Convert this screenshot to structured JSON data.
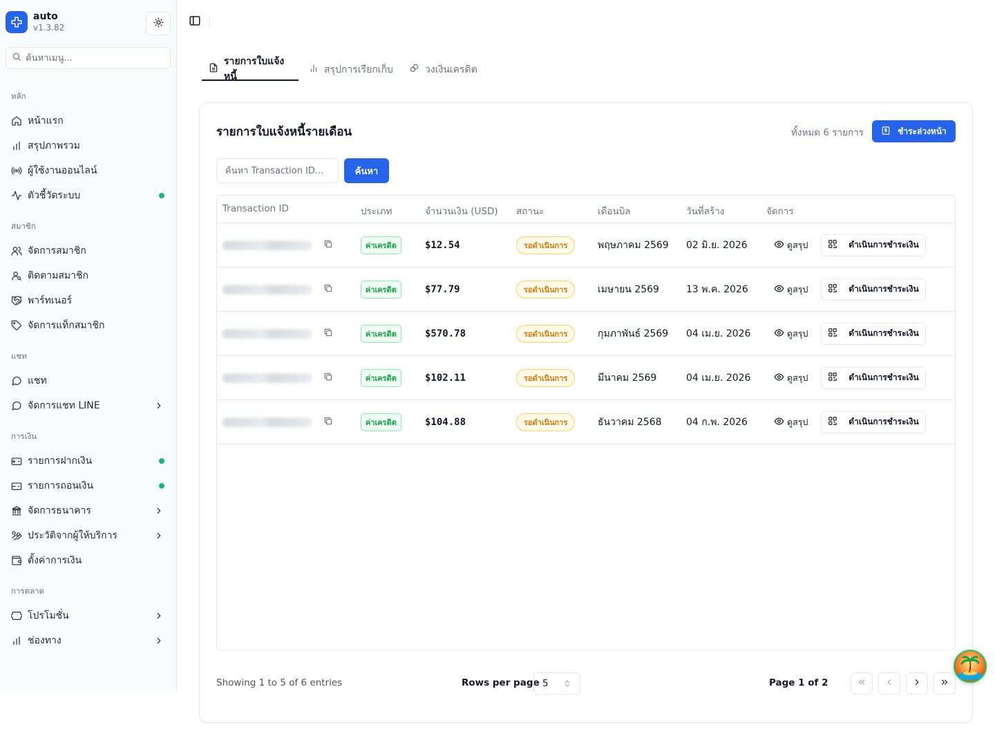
{
  "app": {
    "name": "auto",
    "version": "v1.3.82"
  },
  "sidebar": {
    "search_placeholder": "ค้นหาเมนู...",
    "sections": [
      {
        "label": "หลัก",
        "items": [
          {
            "label": "หน้าแรก",
            "icon": "home-icon"
          },
          {
            "label": "สรุปภาพรวม",
            "icon": "bar-chart-icon"
          },
          {
            "label": "ผู้ใช้งานออนไลน์",
            "icon": "radio-icon"
          },
          {
            "label": "ตัวชี้วัดระบบ",
            "icon": "activity-icon",
            "status_dot": true
          }
        ]
      },
      {
        "label": "สมาชิก",
        "items": [
          {
            "label": "จัดการสมาชิก",
            "icon": "users-icon"
          },
          {
            "label": "ติดตามสมาชิก",
            "icon": "user-search-icon"
          },
          {
            "label": "พาร์ทเนอร์",
            "icon": "handshake-icon"
          },
          {
            "label": "จัดการแท็กสมาชิก",
            "icon": "tag-icon"
          }
        ]
      },
      {
        "label": "แชท",
        "items": [
          {
            "label": "แชท",
            "icon": "message-circle-icon"
          },
          {
            "label": "จัดการแชท LINE",
            "icon": "message-circle-icon",
            "has_children": true
          }
        ]
      },
      {
        "label": "การเงิน",
        "items": [
          {
            "label": "รายการฝากเงิน",
            "icon": "wallet-deposit-icon",
            "status_dot": true
          },
          {
            "label": "รายการถอนเงิน",
            "icon": "wallet-withdraw-icon",
            "status_dot": true
          },
          {
            "label": "จัดการธนาคาร",
            "icon": "bank-icon",
            "has_children": true
          },
          {
            "label": "ประวัติจากผู้ให้บริการ",
            "icon": "hand-coins-icon",
            "has_children": true
          },
          {
            "label": "ตั้งค่าการเงิน",
            "icon": "wallet-settings-icon"
          }
        ]
      },
      {
        "label": "การตลาด",
        "items": [
          {
            "label": "โปรโมชั่น",
            "icon": "ticket-icon",
            "has_children": true
          },
          {
            "label": "ช่องทาง",
            "icon": "bar-chart-icon",
            "has_children": true
          }
        ]
      }
    ]
  },
  "tabs": [
    {
      "label": "รายการใบแจ้งหนี้",
      "icon": "file-text-icon",
      "active": true
    },
    {
      "label": "สรุปการเรียกเก็บ",
      "icon": "bar-chart-icon",
      "active": false
    },
    {
      "label": "วงเงินเครดิต",
      "icon": "link-icon",
      "active": false
    }
  ],
  "card": {
    "title": "รายการใบแจ้งหนี้รายเดือน",
    "total_count": "ทั้งหมด 6 รายการ",
    "prepay_label": "ชำระล่วงหน้า",
    "search_placeholder": "ค้นหา Transaction ID...",
    "search_button": "ค้นหา"
  },
  "table": {
    "columns": [
      "Transaction ID",
      "ประเภท",
      "จำนวนเงิน (USD)",
      "สถานะ",
      "เดือนบิล",
      "วันที่สร้าง",
      "จัดการ"
    ],
    "rows": [
      {
        "type": "ค่าเครดิต",
        "amount": "$12.54",
        "status": "รอดำเนินการ",
        "bill_month": "พฤษภาคม 2569",
        "created": "02 มิ.ย. 2026",
        "view": "ดูสรุป",
        "action": "ดำเนินการชำระเงิน"
      },
      {
        "type": "ค่าเครดิต",
        "amount": "$77.79",
        "status": "รอดำเนินการ",
        "bill_month": "เมษายน 2569",
        "created": "13 พ.ค. 2026",
        "view": "ดูสรุป",
        "action": "ดำเนินการชำระเงิน"
      },
      {
        "type": "ค่าเครดิต",
        "amount": "$570.78",
        "status": "รอดำเนินการ",
        "bill_month": "กุมภาพันธ์ 2569",
        "created": "04 เม.ย. 2026",
        "view": "ดูสรุป",
        "action": "ดำเนินการชำระเงิน"
      },
      {
        "type": "ค่าเครดิต",
        "amount": "$102.11",
        "status": "รอดำเนินการ",
        "bill_month": "มีนาคม 2569",
        "created": "04 เม.ย. 2026",
        "view": "ดูสรุป",
        "action": "ดำเนินการชำระเงิน"
      },
      {
        "type": "ค่าเครดิต",
        "amount": "$104.88",
        "status": "รอดำเนินการ",
        "bill_month": "ธันวาคม 2568",
        "created": "04 ก.พ. 2026",
        "view": "ดูสรุป",
        "action": "ดำเนินการชำระเงิน"
      }
    ]
  },
  "footer": {
    "showing": "Showing 1 to 5 of 6 entries",
    "rows_per_page_label": "Rows per page",
    "rows_per_page_value": "5",
    "page_info": "Page 1 of 2"
  },
  "colors": {
    "primary": "#2563eb",
    "success": "#16a34a",
    "warning": "#d97706",
    "dot": "#10b981"
  }
}
